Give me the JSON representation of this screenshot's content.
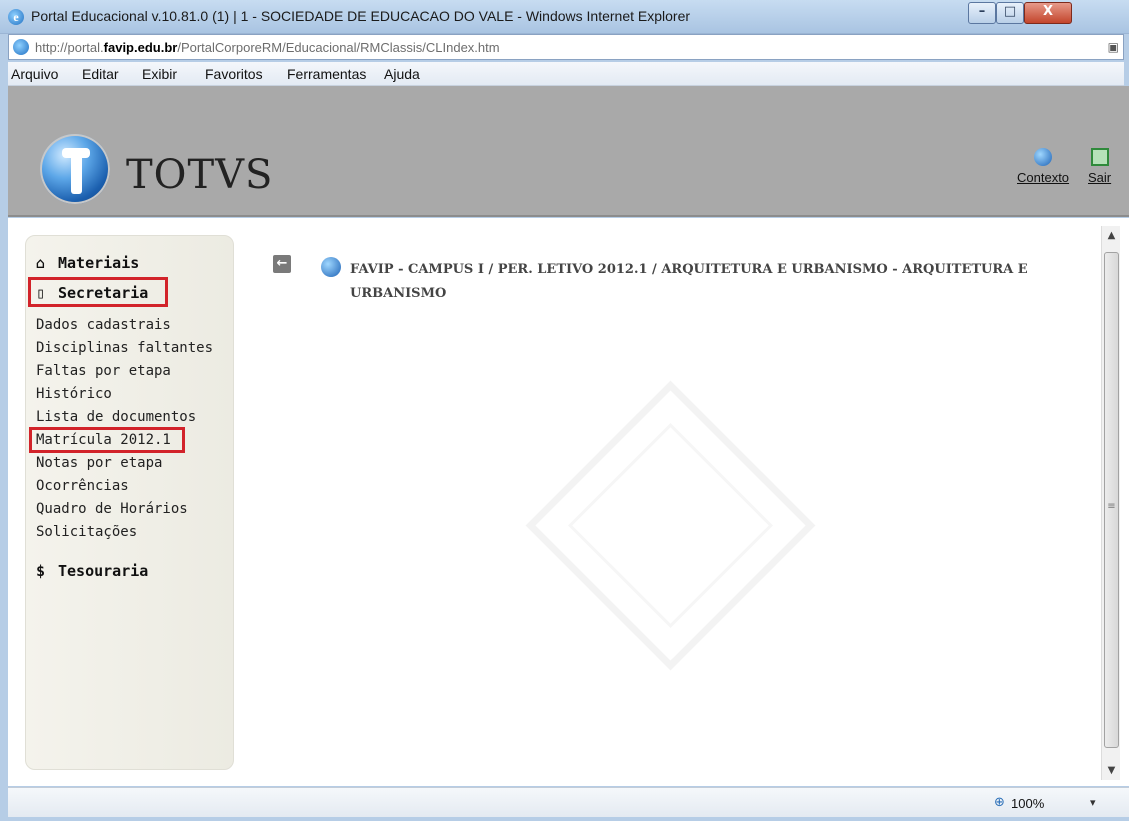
{
  "window": {
    "title": "Portal Educacional v.10.81.0 (1) | 1 - SOCIEDADE DE EDUCACAO DO VALE - Windows Internet Explorer",
    "min_glyph": "–",
    "max_glyph": "□",
    "close_glyph": "X"
  },
  "address": {
    "url_prefix": "http://portal.",
    "url_domain": "favip.edu.br",
    "url_path": "/PortalCorporeRM/Educacional/RMClassis/CLIndex.htm"
  },
  "menu": {
    "items": [
      "Arquivo",
      "Editar",
      "Exibir",
      "Favoritos",
      "Ferramentas",
      "Ajuda"
    ]
  },
  "header": {
    "logo_text": "TOTVS",
    "actions": [
      {
        "label": "Contexto",
        "icon": "globe-icon"
      },
      {
        "label": "Sair",
        "icon": "exit-icon"
      }
    ]
  },
  "sidebar": {
    "sections": [
      {
        "label": "Materiais",
        "icon": "briefcase-icon",
        "glyph": "⌂"
      },
      {
        "label": "Secretaria",
        "icon": "clipboard-icon",
        "glyph": "▯"
      },
      {
        "label": "Tesouraria",
        "icon": "dollar-icon",
        "glyph": "$"
      }
    ],
    "secretaria_links": [
      "Dados cadastrais",
      "Disciplinas faltantes",
      "Faltas por etapa",
      "Histórico",
      "Lista de documentos",
      "Matrícula 2012.1",
      "Notas por etapa",
      "Ocorrências",
      "Quadro de Horários",
      "Solicitações"
    ],
    "highlight_color": "#d2232a"
  },
  "main": {
    "back_glyph": "←",
    "breadcrumb": "FAVIP - CAMPUS I / PER. LETIVO 2012.1  / ARQUITETURA E URBANISMO - ARQUITETURA E URBANISMO"
  },
  "status": {
    "zoom": "100%",
    "zoom_caret": "▾"
  },
  "colors": {
    "header_bg": "#a9a9a9",
    "sidebar_bg": "#f0efe6",
    "frame": "#b6cde6"
  }
}
